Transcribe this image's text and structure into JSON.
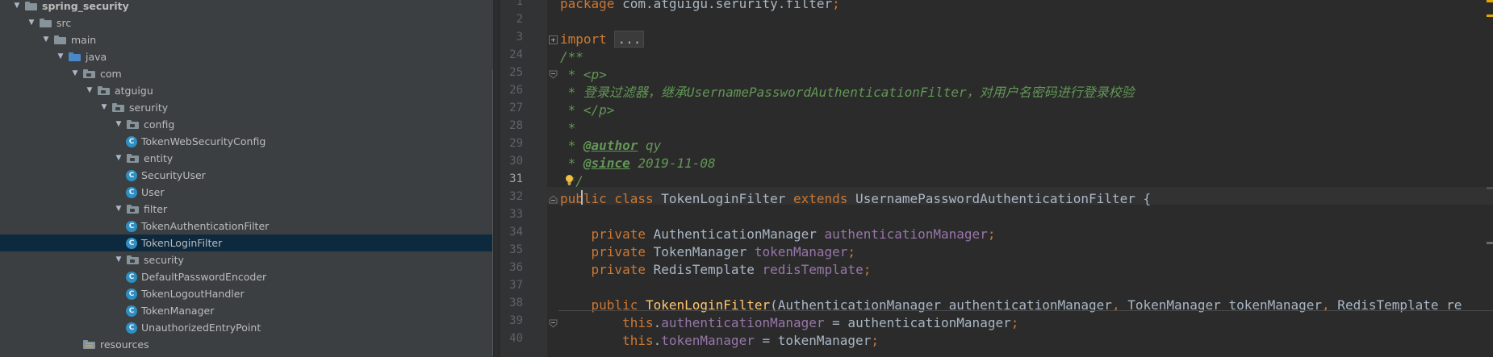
{
  "project_tree": {
    "items": [
      {
        "label": "spring_security",
        "kind": "module",
        "expanded": true
      },
      {
        "label": "src",
        "kind": "folder",
        "expanded": true
      },
      {
        "label": "main",
        "kind": "folder",
        "expanded": true
      },
      {
        "label": "java",
        "kind": "source-root",
        "expanded": true
      },
      {
        "label": "com",
        "kind": "package",
        "expanded": true
      },
      {
        "label": "atguigu",
        "kind": "package",
        "expanded": true
      },
      {
        "label": "serurity",
        "kind": "package",
        "expanded": true
      },
      {
        "label": "config",
        "kind": "package",
        "expanded": true
      },
      {
        "label": "TokenWebSecurityConfig",
        "kind": "class",
        "expanded": false
      },
      {
        "label": "entity",
        "kind": "package",
        "expanded": true
      },
      {
        "label": "SecurityUser",
        "kind": "class",
        "expanded": false
      },
      {
        "label": "User",
        "kind": "class",
        "expanded": false
      },
      {
        "label": "filter",
        "kind": "package",
        "expanded": true
      },
      {
        "label": "TokenAuthenticationFilter",
        "kind": "class",
        "expanded": false
      },
      {
        "label": "TokenLoginFilter",
        "kind": "class",
        "expanded": false,
        "selected": true
      },
      {
        "label": "security",
        "kind": "package",
        "expanded": true
      },
      {
        "label": "DefaultPasswordEncoder",
        "kind": "class",
        "expanded": false
      },
      {
        "label": "TokenLogoutHandler",
        "kind": "class",
        "expanded": false
      },
      {
        "label": "TokenManager",
        "kind": "class",
        "expanded": false
      },
      {
        "label": "UnauthorizedEntryPoint",
        "kind": "class",
        "expanded": false
      },
      {
        "label": "resources",
        "kind": "resources",
        "expanded": false
      }
    ],
    "class_icon_letter": "C"
  },
  "editor": {
    "current_line": "31",
    "line_numbers": [
      "1",
      "2",
      "3",
      "24",
      "25",
      "26",
      "27",
      "28",
      "29",
      "30",
      "31",
      "32",
      "33",
      "34",
      "35",
      "36",
      "37",
      "38",
      "39",
      "40"
    ],
    "lines": [
      [
        {
          "t": "package",
          "c": "kw"
        },
        {
          "t": " com.atguigu.serurity.filter",
          "c": ""
        },
        {
          "t": ";",
          "c": "kw"
        }
      ],
      [],
      [
        {
          "t": "import",
          "c": "kw"
        },
        {
          "t": " ",
          "c": ""
        },
        {
          "t": "...",
          "c": "fold"
        }
      ],
      [
        {
          "t": "/**",
          "c": "cmt"
        }
      ],
      [
        {
          "t": " * <p>",
          "c": "cmt"
        }
      ],
      [
        {
          "t": " * 登录过滤器，继承UsernamePasswordAuthenticationFilter，对用户名密码进行登录校验",
          "c": "cmt"
        }
      ],
      [
        {
          "t": " * </p>",
          "c": "cmt"
        }
      ],
      [
        {
          "t": " *",
          "c": "cmt"
        }
      ],
      [
        {
          "t": " * ",
          "c": "cmt"
        },
        {
          "t": "@author",
          "c": "tag"
        },
        {
          "t": " qy",
          "c": "cval"
        }
      ],
      [
        {
          "t": " * ",
          "c": "cmt"
        },
        {
          "t": "@since",
          "c": "tag"
        },
        {
          "t": " 2019-11-08",
          "c": "cval"
        }
      ],
      [
        {
          "t": " */",
          "c": "cmt"
        }
      ],
      [
        {
          "t": "public class",
          "c": "kw"
        },
        {
          "t": " TokenLoginFilter ",
          "c": ""
        },
        {
          "t": "extends",
          "c": "kw"
        },
        {
          "t": " UsernamePasswordAuthenticationFilter {",
          "c": ""
        }
      ],
      [],
      [
        {
          "t": "    private",
          "c": "kw"
        },
        {
          "t": " AuthenticationManager ",
          "c": ""
        },
        {
          "t": "authenticationManager",
          "c": "fld"
        },
        {
          "t": ";",
          "c": "kw"
        }
      ],
      [
        {
          "t": "    private",
          "c": "kw"
        },
        {
          "t": " TokenManager ",
          "c": ""
        },
        {
          "t": "tokenManager",
          "c": "fld"
        },
        {
          "t": ";",
          "c": "kw"
        }
      ],
      [
        {
          "t": "    private",
          "c": "kw"
        },
        {
          "t": " RedisTemplate ",
          "c": ""
        },
        {
          "t": "redisTemplate",
          "c": "fld"
        },
        {
          "t": ";",
          "c": "kw"
        }
      ],
      [],
      [
        {
          "t": "    public",
          "c": "kw"
        },
        {
          "t": " ",
          "c": ""
        },
        {
          "t": "TokenLoginFilter",
          "c": "mth"
        },
        {
          "t": "(AuthenticationManager authenticationManager",
          "c": ""
        },
        {
          "t": ",",
          "c": "kw"
        },
        {
          "t": " TokenManager tokenManager",
          "c": ""
        },
        {
          "t": ",",
          "c": "kw"
        },
        {
          "t": " RedisTemplate re",
          "c": ""
        }
      ],
      [
        {
          "t": "        this",
          "c": "kw"
        },
        {
          "t": ".",
          "c": ""
        },
        {
          "t": "authenticationManager",
          "c": "fld"
        },
        {
          "t": " = authenticationManager",
          "c": ""
        },
        {
          "t": ";",
          "c": "kw"
        }
      ],
      [
        {
          "t": "        this",
          "c": "kw"
        },
        {
          "t": ".",
          "c": ""
        },
        {
          "t": "tokenManager",
          "c": "fld"
        },
        {
          "t": " = tokenManager",
          "c": ""
        },
        {
          "t": ";",
          "c": "kw"
        }
      ]
    ]
  },
  "colors": {
    "tree_bg": "#3c3f41",
    "editor_bg": "#2b2b2b",
    "selection_bg": "#0d293e",
    "keyword": "#cc7832",
    "field": "#9876aa",
    "doc_comment": "#629755",
    "text": "#a9b7c6",
    "method_declaration": "#ffc66d",
    "folder_grey": "#87939a",
    "source_folder_blue": "#4a88c7",
    "class_icon": "#2e8fc3"
  }
}
